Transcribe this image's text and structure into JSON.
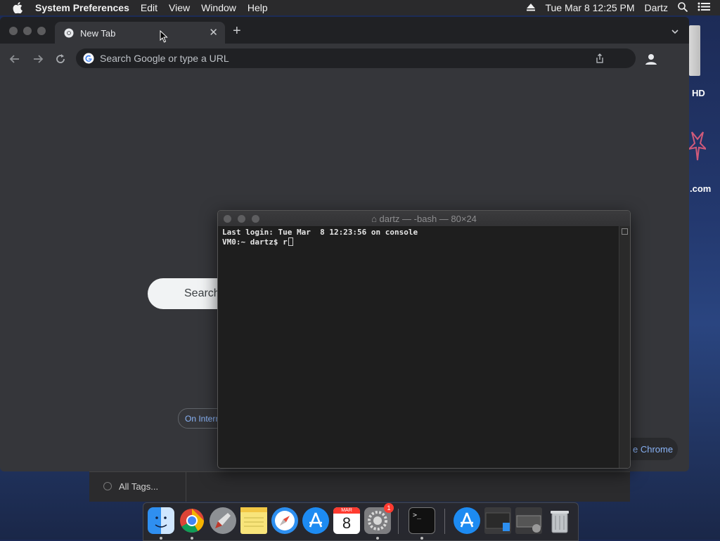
{
  "menubar": {
    "app_name": "System Preferences",
    "menus": [
      "Edit",
      "View",
      "Window",
      "Help"
    ],
    "clock": "Tue Mar 8  12:25 PM",
    "user": "Dartz",
    "icons": [
      "apple-icon",
      "eject-icon",
      "search-icon",
      "control-center-icon"
    ]
  },
  "desktop": {
    "hd_label": "HD",
    "com_label": ".com"
  },
  "chrome": {
    "tab_title": "New Tab",
    "omnibox_placeholder": "Search Google or type a URL",
    "search_pill_text": "Search",
    "internet_button": "On Intern",
    "chrome_button": "e Chrome"
  },
  "tags": {
    "label": "All Tags..."
  },
  "terminal": {
    "title": "dartz — -bash — 80×24",
    "line1": "Last login: Tue Mar  8 12:23:56 on console",
    "prompt": "VM0:~ dartz$ ",
    "typed": "r"
  },
  "dock": {
    "apps": [
      "Finder",
      "Chrome",
      "Launchpad",
      "Notes",
      "Safari",
      "App Store",
      "Calendar",
      "System Preferences",
      "Terminal",
      "App Store Downloads",
      "Recent Items",
      "Trash"
    ],
    "calendar_month": "MAR",
    "calendar_day": "8",
    "sysprefs_badge": "1"
  }
}
